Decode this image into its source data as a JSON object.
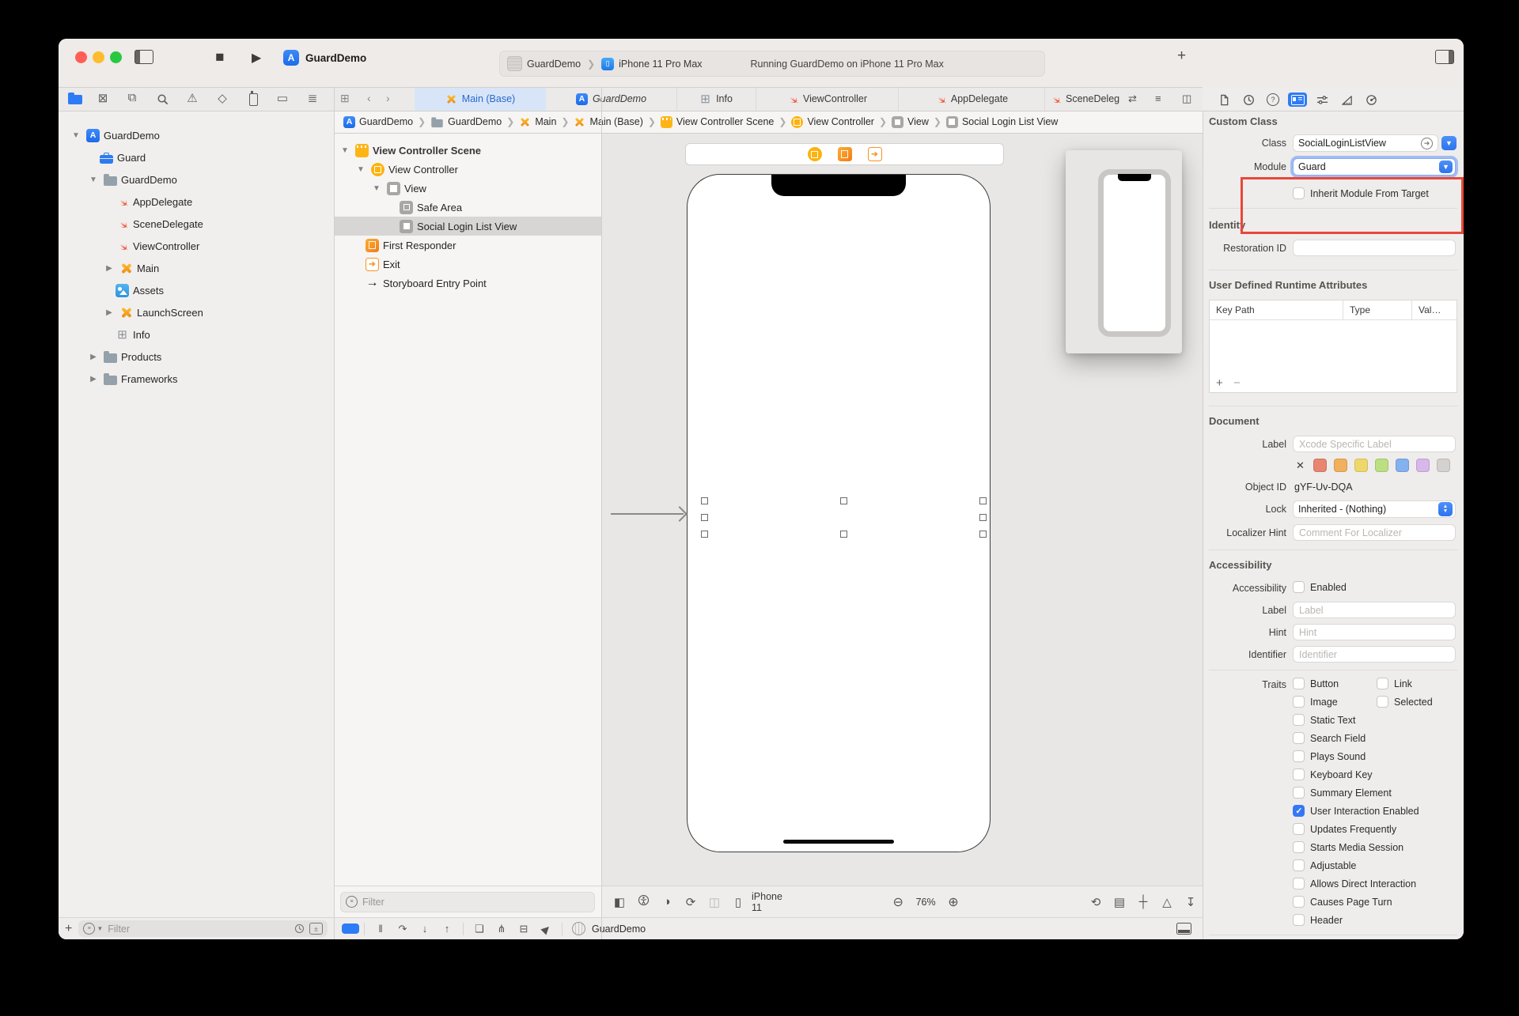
{
  "titlebar": {
    "app_title": "GuardDemo",
    "scheme_project": "GuardDemo",
    "scheme_device": "iPhone 11 Pro Max",
    "status": "Running GuardDemo on iPhone 11 Pro Max",
    "new_tab_label": "+"
  },
  "tabs": [
    {
      "label": "Main (Base)"
    },
    {
      "label": "GuardDemo"
    },
    {
      "label": "Info"
    },
    {
      "label": "ViewController"
    },
    {
      "label": "AppDelegate"
    },
    {
      "label": "SceneDeleg"
    }
  ],
  "jump_bar": {
    "items": [
      {
        "label": "GuardDemo"
      },
      {
        "label": "GuardDemo"
      },
      {
        "label": "Main"
      },
      {
        "label": "Main (Base)"
      },
      {
        "label": "View Controller Scene"
      },
      {
        "label": "View Controller"
      },
      {
        "label": "View"
      },
      {
        "label": "Social Login List View"
      }
    ]
  },
  "navigator": {
    "items": [
      {
        "label": "GuardDemo"
      },
      {
        "label": "Guard"
      },
      {
        "label": "GuardDemo"
      },
      {
        "label": "AppDelegate"
      },
      {
        "label": "SceneDelegate"
      },
      {
        "label": "ViewController"
      },
      {
        "label": "Main"
      },
      {
        "label": "Assets"
      },
      {
        "label": "LaunchScreen"
      },
      {
        "label": "Info"
      },
      {
        "label": "Products"
      },
      {
        "label": "Frameworks"
      }
    ],
    "filter_placeholder": "Filter",
    "add_label": "+"
  },
  "outline": {
    "items": [
      {
        "label": "View Controller Scene"
      },
      {
        "label": "View Controller"
      },
      {
        "label": "View"
      },
      {
        "label": "Safe Area"
      },
      {
        "label": "Social Login List View"
      },
      {
        "label": "First Responder"
      },
      {
        "label": "Exit"
      },
      {
        "label": "Storyboard Entry Point"
      }
    ],
    "filter_placeholder": "Filter"
  },
  "canvas": {
    "device_label": "iPhone 11",
    "zoom_level": "76%"
  },
  "debug_bar": {
    "process_name": "GuardDemo"
  },
  "inspector": {
    "custom_class": {
      "title": "Custom Class",
      "class_label": "Class",
      "class_value": "SocialLoginListView",
      "module_label": "Module",
      "module_value": "Guard",
      "inherit_label": "Inherit Module From Target"
    },
    "identity": {
      "title": "Identity",
      "restoration_label": "Restoration ID"
    },
    "udra": {
      "title": "User Defined Runtime Attributes",
      "col_keypath": "Key Path",
      "col_type": "Type",
      "col_value": "Val…",
      "add_label": "+",
      "remove_label": "−"
    },
    "document": {
      "title": "Document",
      "label_label": "Label",
      "label_placeholder": "Xcode Specific Label",
      "object_id_label": "Object ID",
      "object_id_value": "gYF-Uv-DQA",
      "lock_label": "Lock",
      "lock_value": "Inherited - (Nothing)",
      "localizer_label": "Localizer Hint",
      "localizer_placeholder": "Comment For Localizer",
      "swatch_clear": "✕",
      "swatch_colors": [
        "#E8846F",
        "#F0B05E",
        "#EFD86B",
        "#BCDF82",
        "#84B1EF",
        "#D8B7EB",
        "#D4D1CE"
      ]
    },
    "accessibility": {
      "title": "Accessibility",
      "row_label": "Accessibility",
      "enabled_label": "Enabled",
      "label_label": "Label",
      "label_placeholder": "Label",
      "hint_label": "Hint",
      "hint_placeholder": "Hint",
      "identifier_label": "Identifier",
      "identifier_placeholder": "Identifier",
      "traits_label": "Traits",
      "traits": [
        {
          "label": "Button",
          "checked": false
        },
        {
          "label": "Link",
          "checked": false
        },
        {
          "label": "Image",
          "checked": false
        },
        {
          "label": "Selected",
          "checked": false
        },
        {
          "label": "Static Text",
          "checked": false
        },
        {
          "label": "Search Field",
          "checked": false
        },
        {
          "label": "Plays Sound",
          "checked": false
        },
        {
          "label": "Keyboard Key",
          "checked": false
        },
        {
          "label": "Summary Element",
          "checked": false
        },
        {
          "label": "User Interaction Enabled",
          "checked": true
        },
        {
          "label": "Updates Frequently",
          "checked": false
        },
        {
          "label": "Starts Media Session",
          "checked": false
        },
        {
          "label": "Adjustable",
          "checked": false
        },
        {
          "label": "Allows Direct Interaction",
          "checked": false
        },
        {
          "label": "Causes Page Turn",
          "checked": false
        },
        {
          "label": "Header",
          "checked": false
        }
      ]
    }
  },
  "colors": {
    "accent_blue": "#3478F6",
    "annotation_red": "#E8473C",
    "swift_orange": "#F05138",
    "storyboard_orange": "#F2A33C",
    "scene_yellow": "#FDB515"
  }
}
